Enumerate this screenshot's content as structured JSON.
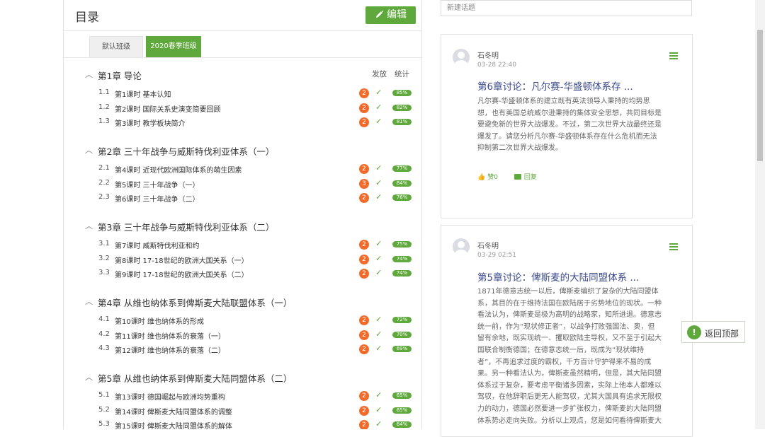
{
  "toc": {
    "title": "目录",
    "edit_label": "编辑",
    "tabs": [
      "默认班级",
      "2020春季班级"
    ],
    "col_release": "发放",
    "col_stats": "统计",
    "chapters": [
      {
        "title": "第1章 导论",
        "lessons": [
          {
            "num": "1.1",
            "title": "第1课时 基本认知",
            "badge": "2",
            "pct": "85%"
          },
          {
            "num": "1.2",
            "title": "第2课时 国际关系史演变简要回顾",
            "badge": "2",
            "pct": "82%"
          },
          {
            "num": "1.3",
            "title": "第3课时 教学板块简介",
            "badge": "2",
            "pct": "81%"
          }
        ]
      },
      {
        "title": "第2章 三十年战争与威斯特伐利亚体系（一）",
        "lessons": [
          {
            "num": "2.1",
            "title": "第4课时 近现代欧洲国际体系的萌生因素",
            "badge": "2",
            "pct": "77%"
          },
          {
            "num": "2.2",
            "title": "第5课时 三十年战争（一）",
            "badge": "3",
            "pct": "84%"
          },
          {
            "num": "2.3",
            "title": "第6课时 三十年战争（二）",
            "badge": "2",
            "pct": "76%"
          }
        ]
      },
      {
        "title": "第3章 三十年战争与威斯特伐利亚体系（二）",
        "lessons": [
          {
            "num": "3.1",
            "title": "第7课时 威斯特伐利亚和约",
            "badge": "2",
            "pct": "75%"
          },
          {
            "num": "3.2",
            "title": "第8课时 17-18世纪的欧洲大国关系（一）",
            "badge": "2",
            "pct": "74%"
          },
          {
            "num": "3.3",
            "title": "第9课时 17-18世纪的欧洲大国关系（二）",
            "badge": "2",
            "pct": "74%"
          }
        ]
      },
      {
        "title": "第4章 从维也纳体系到俾斯麦大陆联盟体系（一）",
        "lessons": [
          {
            "num": "4.1",
            "title": "第10课时 维也纳体系的形成",
            "badge": "2",
            "pct": "72%"
          },
          {
            "num": "4.2",
            "title": "第11课时 维也纳体系的衰落（一）",
            "badge": "2",
            "pct": "70%"
          },
          {
            "num": "4.3",
            "title": "第12课时 维也纳体系的衰落（二）",
            "badge": "2",
            "pct": "69%"
          }
        ]
      },
      {
        "title": "第5章 从维也纳体系到俾斯麦大陆同盟体系（二）",
        "lessons": [
          {
            "num": "5.1",
            "title": "第13课时 德国崛起与欧洲均势重构",
            "badge": "2",
            "pct": "65%"
          },
          {
            "num": "5.2",
            "title": "第14课时 俾斯麦大陆同盟体系的调整",
            "badge": "2",
            "pct": "65%"
          },
          {
            "num": "5.3",
            "title": "第15课时 俾斯麦大陆同盟体系的解体",
            "badge": "2",
            "pct": "64%"
          }
        ]
      }
    ]
  },
  "new_topic_placeholder": "新建话题",
  "posts": [
    {
      "author": "石冬明",
      "time": "03-28 22:40",
      "title": "第6章讨论：凡尔赛-华盛顿体系存 ...",
      "lines": [
        "凡尔赛-华盛顿体系的建立既有英法领导人秉持的均势思",
        "想，也有美国总统威尔逊秉持的集体安全思想，共同目标是",
        "要避免新的世界大战爆发。不过，第二次世界大战最终还是",
        "爆发了。请您分析凡尔赛-华盛顿体系存在什么危机而无法",
        "抑制第二次世界大战爆发。"
      ],
      "likes": "赞0",
      "reply": "回复"
    },
    {
      "author": "石冬明",
      "time": "03-29 02:51",
      "title": "第5章讨论：俾斯麦的大陆同盟体系 ...",
      "lines": [
        "1871年德意志统一以后，俾斯麦编织了复杂的大陆同盟体",
        "系，其目的在于维持法国在欧陆居于劣势地位的现状。一种",
        "看法认为，俾斯麦是极为高明的战略家，知所进退。德意志",
        "统一前，作为“现状修正者”，以战争打败强国法、奥，但",
        "留有余地，既实现统一、攫取欧陆主导权，又不至于引起大",
        "国联合制衡德国；在德意志统一后，既成为“现状维持",
        "者”，不再追求过度的霸权，千方百计守护得来不易的成",
        "果。另一种看法认为，俾斯麦虽然精明，但是，其大陆同盟",
        "体系过于复杂，要考虑平衡诸多因素，实际上他本人都难以",
        "驾驭，在他辞职后更无人能驾驭，尤其大国具有追求无限权",
        "力的动力，德国必然要进一步扩张权力，俾斯麦的大陆同盟",
        "体系势必走向失败。分析以上观点，您是如何看待俾斯麦大"
      ]
    }
  ],
  "back_to_top": "返回顶部",
  "colors": {
    "accent": "#5fa93c",
    "badge": "#f26b2a",
    "link": "#3b4a8c"
  }
}
